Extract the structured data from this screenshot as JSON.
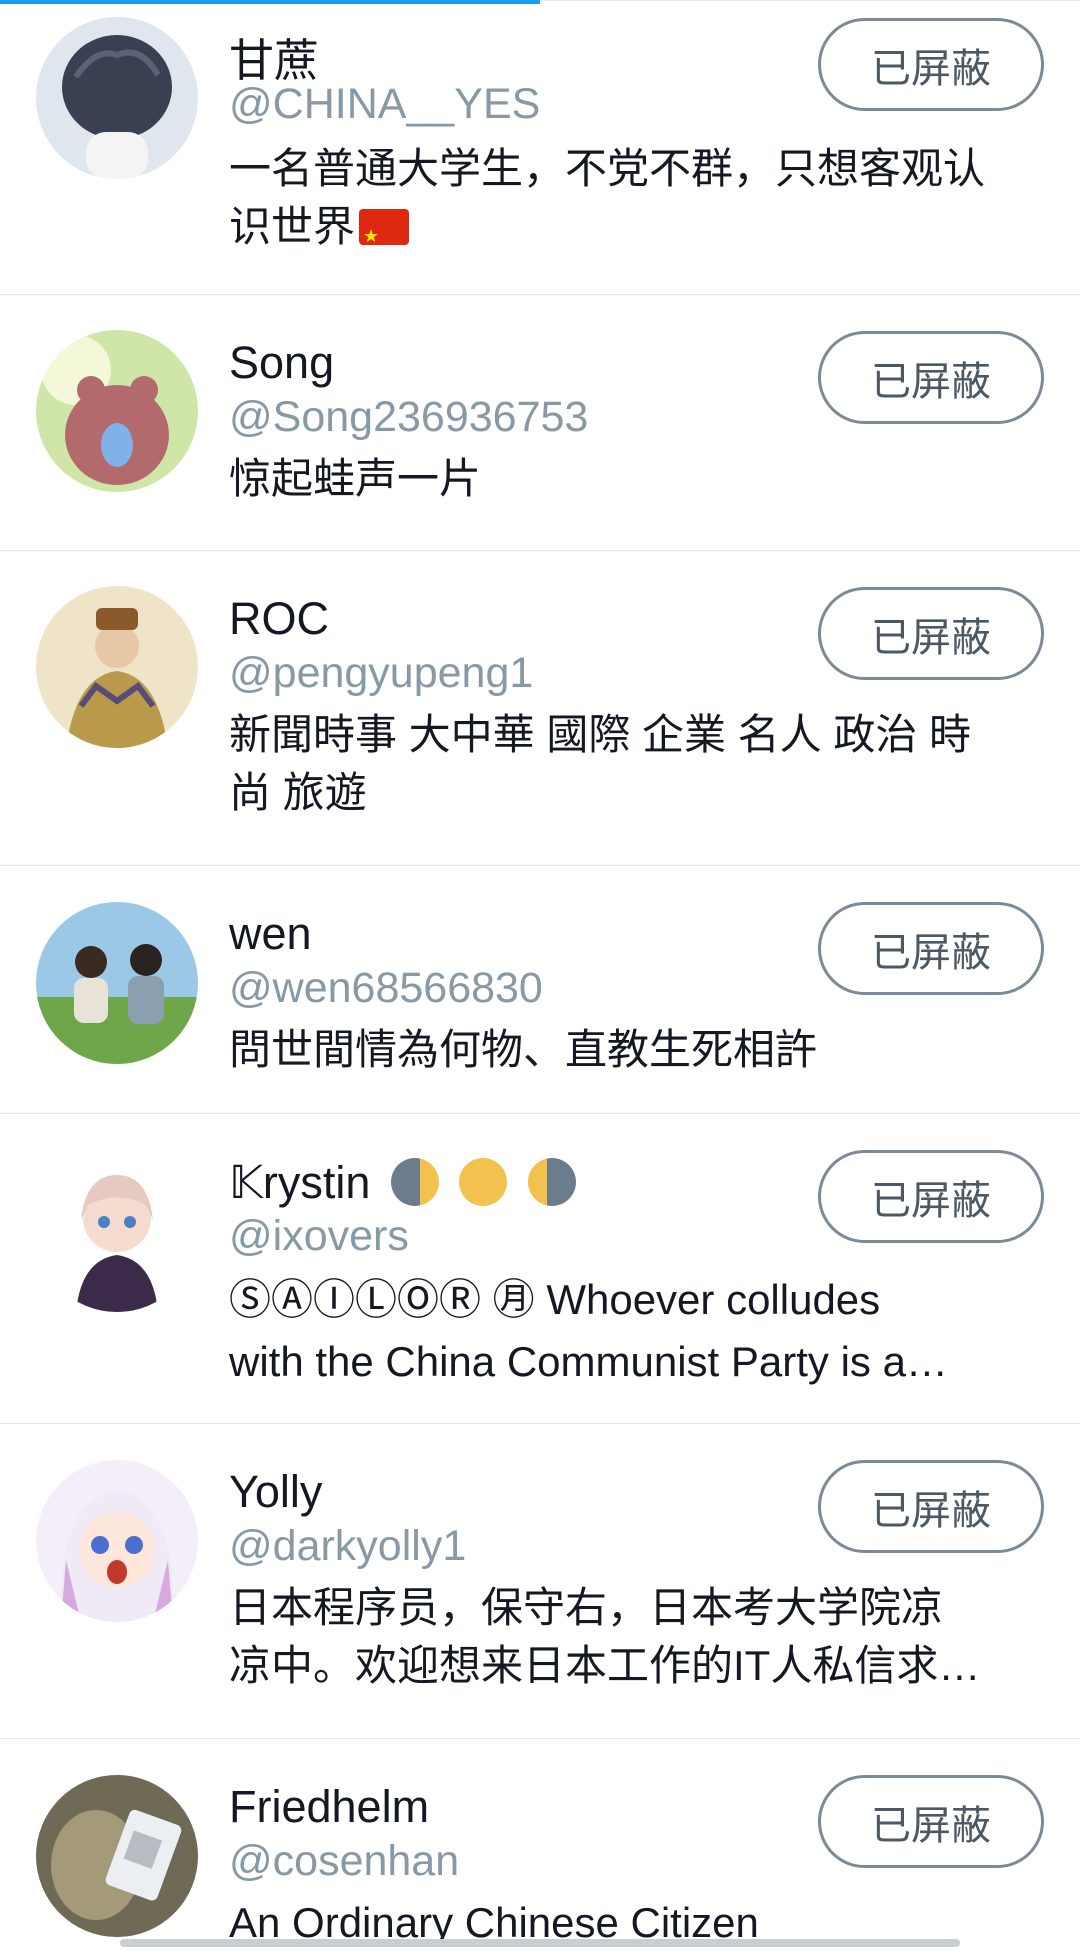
{
  "blocked_label": "已屏蔽",
  "users": [
    {
      "name": "甘蔗",
      "handle": "@CHINA__YES",
      "bio": [
        "一名普通大学生，不党不群，只想客观认",
        "识世界"
      ],
      "flag": true
    },
    {
      "name": "Song",
      "handle": "@Song236936753",
      "bio": [
        "惊起蛙声一片"
      ]
    },
    {
      "name": "ROC",
      "handle": "@pengyupeng1",
      "bio": [
        "新聞時事 大中華 國際 企業 名人 政治 時",
        "尚 旅遊"
      ]
    },
    {
      "name": "wen",
      "handle": "@wen68566830",
      "bio": [
        "問世間情為何物、直教生死相許"
      ]
    },
    {
      "name": "𝕂rystin",
      "handle": "@ixovers",
      "bio": [
        "ⓈⒶⒾⓁⓄⓇ ㊊ Whoever colludes",
        "with the China Communist Party is a…"
      ],
      "moons": true
    },
    {
      "name": "Yolly",
      "handle": "@darkyolly1",
      "bio": [
        "日本程序员，保守右，日本考大学院凉",
        "凉中。欢迎想来日本工作的IT人私信求…"
      ]
    },
    {
      "name": "Friedhelm",
      "handle": "@cosenhan",
      "bio": [
        "An Ordinary Chinese Citizen"
      ]
    }
  ],
  "colors": {
    "accent": "#1d9bf0",
    "handle": "#8899a6",
    "button_border": "#7b8a96"
  }
}
